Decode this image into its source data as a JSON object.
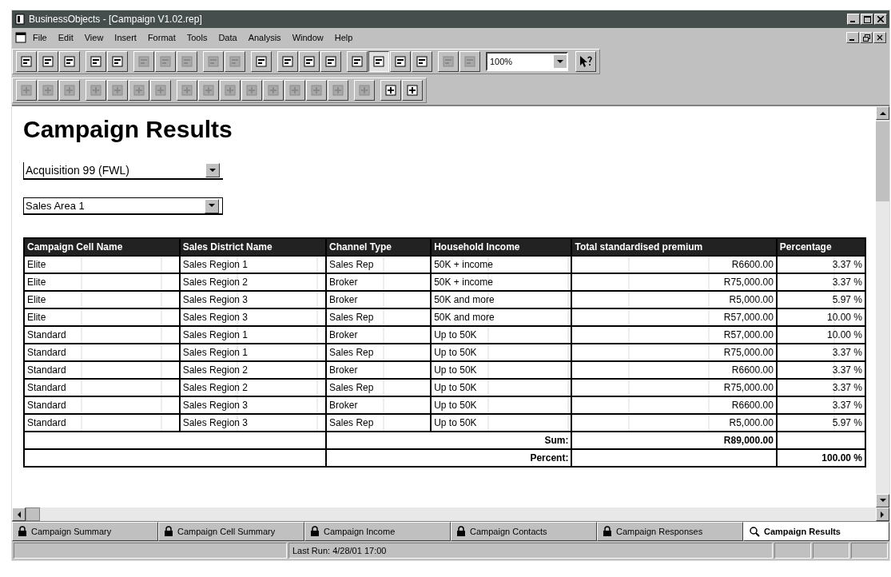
{
  "window": {
    "title": "BusinessObjects - [Campaign V1.02.rep]"
  },
  "menu": [
    "File",
    "Edit",
    "View",
    "Insert",
    "Format",
    "Tools",
    "Data",
    "Analysis",
    "Window",
    "Help"
  ],
  "zoom": {
    "value": "100%"
  },
  "report": {
    "title": "Campaign Results",
    "filters": [
      {
        "value": "Acquisition 99 (FWL)"
      },
      {
        "value": "Sales Area 1"
      }
    ],
    "table": {
      "columns": [
        "Campaign Cell Name",
        "Sales District Name",
        "Channel Type",
        "Household Income",
        "Total standardised premium",
        "Percentage"
      ],
      "rows": [
        [
          "Elite",
          "Sales Region 1",
          "Sales Rep",
          "50K + income",
          "R6600.00",
          "3.37 %"
        ],
        [
          "Elite",
          "Sales Region 2",
          "Broker",
          "50K + income",
          "R75,000.00",
          "3.37 %"
        ],
        [
          "Elite",
          "Sales Region 3",
          "Broker",
          "50K and more",
          "R5,000.00",
          "5.97 %"
        ],
        [
          "Elite",
          "Sales Region 3",
          "Sales Rep",
          "50K and more",
          "R57,000.00",
          "10.00 %"
        ],
        [
          "Standard",
          "Sales Region 1",
          "Broker",
          "Up to 50K",
          "R57,000.00",
          "10.00 %"
        ],
        [
          "Standard",
          "Sales Region 1",
          "Sales Rep",
          "Up to 50K",
          "R75,000.00",
          "3.37 %"
        ],
        [
          "Standard",
          "Sales Region 2",
          "Broker",
          "Up to 50K",
          "R6600.00",
          "3.37 %"
        ],
        [
          "Standard",
          "Sales Region 2",
          "Sales Rep",
          "Up to 50K",
          "R75,000.00",
          "3.37 %"
        ],
        [
          "Standard",
          "Sales Region 3",
          "Broker",
          "Up to 50K",
          "R6600.00",
          "3.37 %"
        ],
        [
          "Standard",
          "Sales Region 3",
          "Sales Rep",
          "Up to 50K",
          "R5,000.00",
          "5.97 %"
        ]
      ],
      "sum": {
        "label": "Sum:",
        "value": "R89,000.00"
      },
      "percent": {
        "label": "Percent:",
        "value": "100.00 %"
      }
    }
  },
  "tabs": [
    {
      "label": "Campaign Summary",
      "selected": false
    },
    {
      "label": "Campaign Cell Summary",
      "selected": false
    },
    {
      "label": "Campaign Income",
      "selected": false
    },
    {
      "label": "Campaign Contacts",
      "selected": false
    },
    {
      "label": "Campaign Responses",
      "selected": false
    },
    {
      "label": "Campaign Results",
      "selected": true
    }
  ],
  "status_bar": {
    "text": "Last Run: 4/28/01 17:00"
  }
}
